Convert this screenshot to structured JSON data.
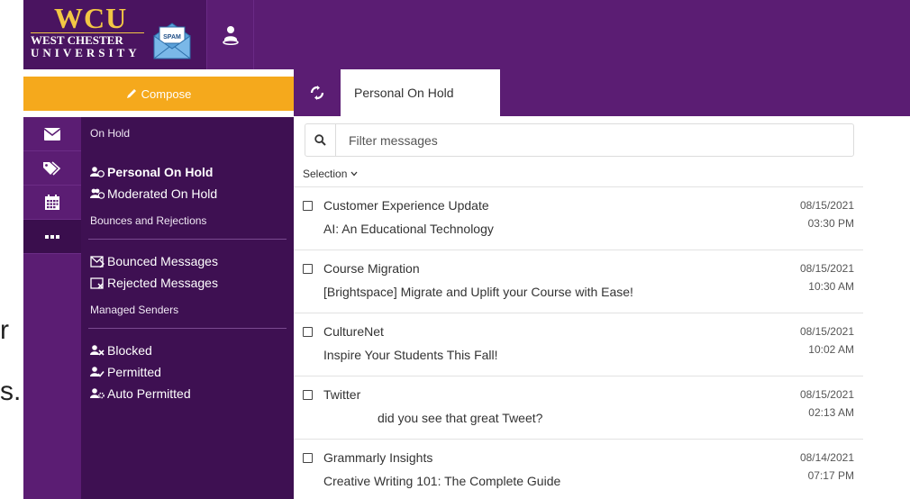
{
  "slide": {
    "fragment1": "r",
    "fragment2": "s."
  },
  "brand": {
    "wcu": "WCU",
    "west_chester": "WEST CHESTER",
    "university": "UNIVERSITY",
    "spam_tag": "SPAM",
    "purple": "#5b1d73",
    "gold": "#f5a91c"
  },
  "compose": {
    "label": "Compose",
    "icon": "pencil-icon"
  },
  "tab": {
    "label": "Personal On Hold"
  },
  "search": {
    "placeholder": "Filter messages",
    "value": ""
  },
  "selection": {
    "label": "Selection"
  },
  "rail": [
    {
      "icon": "envelope-icon"
    },
    {
      "icon": "tags-icon"
    },
    {
      "icon": "calendar-icon"
    },
    {
      "icon": "more-icon",
      "active": true
    }
  ],
  "nav": {
    "on_hold_header": "On Hold",
    "personal_on_hold": "Personal On Hold",
    "moderated_on_hold": "Moderated On Hold",
    "bounces_header": "Bounces and Rejections",
    "bounced_messages": "Bounced Messages",
    "rejected_messages": "Rejected Messages",
    "managed_header": "Managed Senders",
    "blocked": "Blocked",
    "permitted": "Permitted",
    "auto_permitted": "Auto Permitted"
  },
  "messages": [
    {
      "from": "Customer Experience Update",
      "subject": "AI: An Educational Technology",
      "date": "08/15/2021",
      "time": "03:30 PM"
    },
    {
      "from": "Course Migration",
      "subject": "[Brightspace] Migrate and Uplift your Course with Ease!",
      "date": "08/15/2021",
      "time": "10:30 AM"
    },
    {
      "from": "CultureNet",
      "subject": "Inspire Your Students This Fall!",
      "date": "08/15/2021",
      "time": "10:02 AM"
    },
    {
      "from": "Twitter",
      "subject": "did you see that great Tweet?",
      "date": "08/15/2021",
      "time": "02:13 AM"
    },
    {
      "from": "Grammarly Insights",
      "subject": "Creative Writing 101: The Complete Guide",
      "date": "08/14/2021",
      "time": "07:17 PM"
    }
  ]
}
